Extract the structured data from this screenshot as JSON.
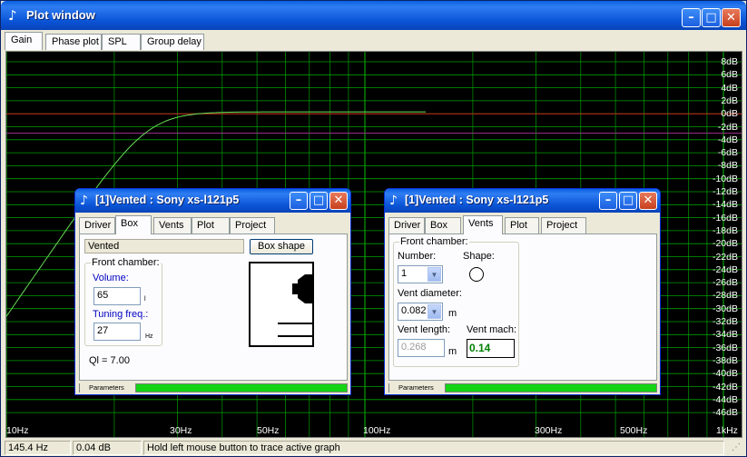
{
  "window": {
    "title": "Plot window"
  },
  "tabs": [
    "Gain",
    "Phase plot",
    "SPL",
    "Group delay"
  ],
  "plot": {
    "y_labels": [
      "8dB",
      "6dB",
      "4dB",
      "2dB",
      "0dB",
      "-2dB",
      "-4dB",
      "-6dB",
      "-8dB",
      "-10dB",
      "-12dB",
      "-14dB",
      "-16dB",
      "-18dB",
      "-20dB",
      "-22dB",
      "-24dB",
      "-26dB",
      "-28dB",
      "-30dB",
      "-32dB",
      "-34dB",
      "-36dB",
      "-38dB",
      "-40dB",
      "-42dB",
      "-44dB",
      "-46dB"
    ],
    "x_labels": [
      "10Hz",
      "30Hz",
      "50Hz",
      "100Hz",
      "300Hz",
      "500Hz",
      "1kHz"
    ],
    "colors": {
      "grid": "#00a000",
      "curve": "#66dd55",
      "ref_line": "#cc2020",
      "ref_line2": "#a03090"
    }
  },
  "status": {
    "freq": "145.4 Hz",
    "gain": "0.04 dB",
    "hint": "Hold left mouse button to trace active graph"
  },
  "box_window": {
    "title": "[1]Vented : Sony xs-l121p5",
    "tabs": [
      "Driver",
      "Box",
      "Vents",
      "Plot",
      "Project"
    ],
    "box_type": "Vented",
    "box_shape_label": "Box shape",
    "front_chamber_label": "Front chamber:",
    "volume_label": "Volume:",
    "volume_value": "65",
    "volume_unit": "l",
    "tuning_label": "Tuning freq.:",
    "tuning_value": "27",
    "tuning_unit": "Hz",
    "ql": "Ql = 7.00",
    "parameters_label": "Parameters"
  },
  "vents_window": {
    "title": "[1]Vented : Sony xs-l121p5",
    "tabs": [
      "Driver",
      "Box",
      "Vents",
      "Plot",
      "Project"
    ],
    "front_chamber_label": "Front chamber:",
    "number_label": "Number:",
    "number_value": "1",
    "shape_label": "Shape:",
    "diameter_label": "Vent diameter:",
    "diameter_value": "0.082",
    "diameter_unit": "m",
    "length_label": "Vent length:",
    "length_value": "0.268",
    "length_unit": "m",
    "mach_label": "Vent mach:",
    "mach_value": "0.14",
    "parameters_label": "Parameters"
  }
}
